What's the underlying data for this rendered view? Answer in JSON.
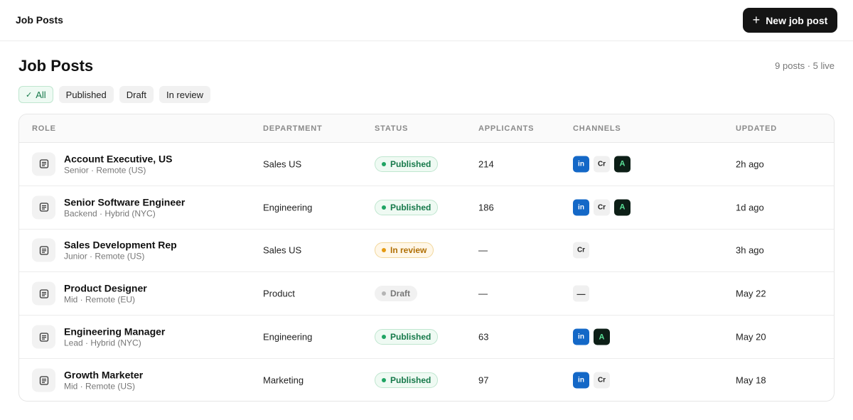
{
  "header": {
    "title": "Job Posts",
    "new_button_label": "New job post",
    "new_button_icon": "plus-icon"
  },
  "page": {
    "title": "Job Posts",
    "summary": "9 posts · 5 live"
  },
  "filters": [
    {
      "label": "All",
      "active": true
    },
    {
      "label": "Published",
      "active": false
    },
    {
      "label": "Draft",
      "active": false
    },
    {
      "label": "In review",
      "active": false
    }
  ],
  "table": {
    "columns": [
      "ROLE",
      "DEPARTMENT",
      "STATUS",
      "APPLICANTS",
      "CHANNELS",
      "UPDATED"
    ],
    "rows": [
      {
        "title": "Account Executive, US",
        "subtitle": "Senior · Remote (US)",
        "department": "Sales US",
        "status": "Published",
        "status_type": "published",
        "applicants": "214",
        "channels": [
          "in",
          "Cr",
          "A"
        ],
        "updated": "2h ago"
      },
      {
        "title": "Senior Software Engineer",
        "subtitle": "Backend · Hybrid (NYC)",
        "department": "Engineering",
        "status": "Published",
        "status_type": "published",
        "applicants": "186",
        "channels": [
          "in",
          "Cr",
          "A"
        ],
        "updated": "1d ago"
      },
      {
        "title": "Sales Development Rep",
        "subtitle": "Junior · Remote (US)",
        "department": "Sales US",
        "status": "In review",
        "status_type": "review",
        "applicants": "—",
        "channels": [
          "Cr"
        ],
        "updated": "3h ago"
      },
      {
        "title": "Product Designer",
        "subtitle": "Mid · Remote (EU)",
        "department": "Product",
        "status": "Draft",
        "status_type": "draft",
        "applicants": "—",
        "channels": [
          "—"
        ],
        "updated": "May 22"
      },
      {
        "title": "Engineering Manager",
        "subtitle": "Lead · Hybrid (NYC)",
        "department": "Engineering",
        "status": "Published",
        "status_type": "published",
        "applicants": "63",
        "channels": [
          "in",
          "A"
        ],
        "updated": "May 20"
      },
      {
        "title": "Growth Marketer",
        "subtitle": "Mid · Remote (US)",
        "department": "Marketing",
        "status": "Published",
        "status_type": "published",
        "applicants": "97",
        "channels": [
          "in",
          "Cr"
        ],
        "updated": "May 18"
      }
    ]
  },
  "colors": {
    "accent_green": "#16794a",
    "button_dark": "#141414",
    "linkedin_blue": "#1468c7",
    "review_amber": "#b06f05"
  }
}
